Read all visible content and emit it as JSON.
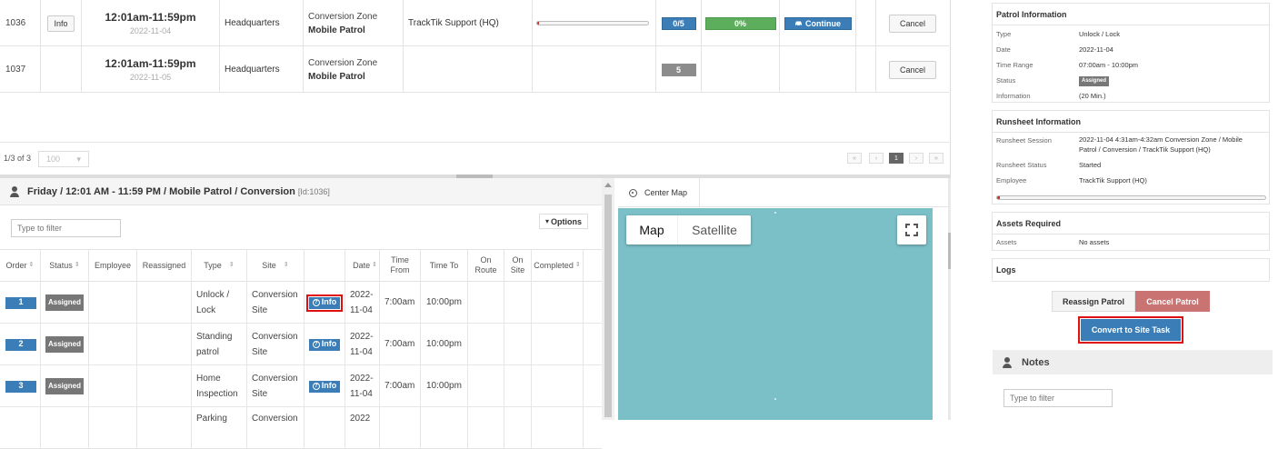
{
  "top_table": {
    "rows": [
      {
        "id": "1036",
        "info_label": "Info",
        "time_range": "12:01am-11:59pm",
        "date": "2022-11-04",
        "site": "Headquarters",
        "zone": "Conversion Zone",
        "patrol_type": "Mobile Patrol",
        "assignee": "TrackTik Support (HQ)",
        "progress_fraction": 0.02,
        "count": "0/5",
        "percent": "0%",
        "continue_label": "Continue",
        "cancel_label": "Cancel"
      },
      {
        "id": "1037",
        "time_range": "12:01am-11:59pm",
        "date": "2022-11-05",
        "site": "Headquarters",
        "zone": "Conversion Zone",
        "patrol_type": "Mobile Patrol",
        "count": "5",
        "cancel_label": "Cancel"
      }
    ],
    "pager": {
      "count": "1/3 of 3",
      "page_size": "100",
      "current_page": "1"
    }
  },
  "detail": {
    "title": "Friday / 12:01 AM - 11:59 PM / Mobile Patrol / Conversion",
    "id_label": "[Id:1036]",
    "filter_placeholder": "Type to filter",
    "options_label": "Options",
    "columns": [
      "Order",
      "Status",
      "Employee",
      "Reassigned",
      "Type",
      "Site",
      "",
      "Date",
      "Time From",
      "Time To",
      "On Route",
      "On Site",
      "Completed"
    ],
    "rows": [
      {
        "order": "1",
        "status": "Assigned",
        "type": "Unlock / Lock",
        "site": "Conversion Site",
        "info": "Info",
        "date": "2022-11-04",
        "time_from": "7:00am",
        "time_to": "10:00pm"
      },
      {
        "order": "2",
        "status": "Assigned",
        "type": "Standing patrol",
        "site": "Conversion Site",
        "info": "Info",
        "date": "2022-11-04",
        "time_from": "7:00am",
        "time_to": "10:00pm"
      },
      {
        "order": "3",
        "status": "Assigned",
        "type": "Home Inspection",
        "site": "Conversion Site",
        "info": "Info",
        "date": "2022-11-04",
        "time_from": "7:00am",
        "time_to": "10:00pm"
      },
      {
        "type": "Parking",
        "site": "Conversion",
        "date": "2022"
      }
    ]
  },
  "map": {
    "tab_label": "Center Map",
    "map_option": "Map",
    "satellite_option": "Satellite",
    "water_color": "#7bbfc7"
  },
  "right_panel": {
    "patrol_info": {
      "title": "Patrol Information",
      "items": [
        {
          "key": "Type",
          "value": "Unlock / Lock"
        },
        {
          "key": "Date",
          "value": "2022-11-04"
        },
        {
          "key": "Time Range",
          "value": "07:00am - 10:00pm"
        },
        {
          "key": "Status",
          "value": "Assigned"
        },
        {
          "key": "Information",
          "value": "(20 Min.)"
        }
      ]
    },
    "runsheet_info": {
      "title": "Runsheet Information",
      "items": [
        {
          "key": "Runsheet Session",
          "value": "2022-11-04 4:31am-4:32am Conversion Zone / Mobile Patrol / Conversion / TrackTik Support (HQ)"
        },
        {
          "key": "Runsheet Status",
          "value": "Started"
        },
        {
          "key": "Employee",
          "value": "TrackTik Support (HQ)"
        }
      ],
      "progress_fraction": 0.01
    },
    "assets": {
      "title": "Assets Required",
      "key": "Assets",
      "value": "No assets"
    },
    "logs": {
      "title": "Logs"
    },
    "reassign_label": "Reassign Patrol",
    "cancel_patrol_label": "Cancel Patrol",
    "convert_label": "Convert to Site Task",
    "notes": {
      "title": "Notes",
      "filter_placeholder": "Type to filter"
    }
  }
}
